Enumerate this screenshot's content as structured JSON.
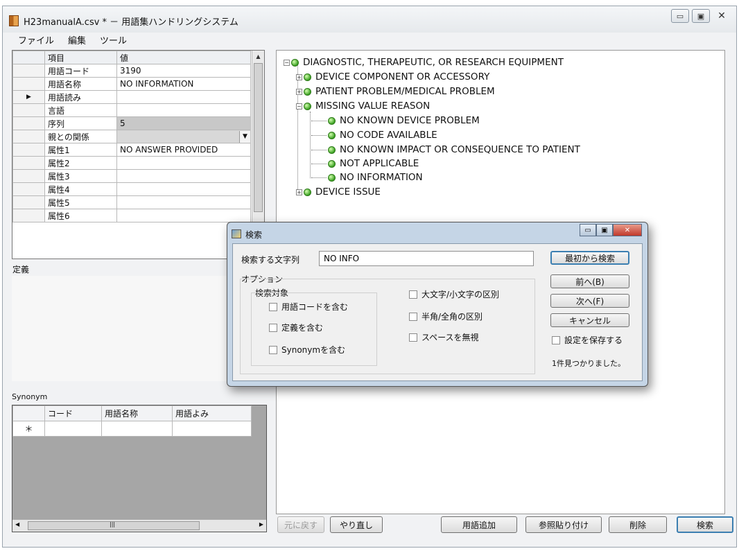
{
  "window": {
    "title": "H23manualA.csv * － 用語集ハンドリングシステム",
    "controls": {
      "minimize": "▭",
      "maximize": "▣",
      "close": "✕"
    }
  },
  "menu": [
    "ファイル",
    "編集",
    "ツール"
  ],
  "property_grid": {
    "headers": {
      "key": "項目",
      "value": "値"
    },
    "selected_row_marker": "▶",
    "rows": [
      {
        "key": "用語コード",
        "value": "3190"
      },
      {
        "key": "用語名称",
        "value": "NO INFORMATION"
      },
      {
        "key": "用語読み",
        "value": ""
      },
      {
        "key": "言語",
        "value": ""
      },
      {
        "key": "序列",
        "value": "5"
      },
      {
        "key": "親との関係",
        "value": ""
      },
      {
        "key": "属性1",
        "value": "NO ANSWER PROVIDED"
      },
      {
        "key": "属性2",
        "value": ""
      },
      {
        "key": "属性3",
        "value": ""
      },
      {
        "key": "属性4",
        "value": ""
      },
      {
        "key": "属性5",
        "value": ""
      },
      {
        "key": "属性6",
        "value": ""
      }
    ]
  },
  "definition": {
    "label": "定義"
  },
  "synonym": {
    "label": "Synonym",
    "headers": [
      "コード",
      "用語名称",
      "用語よみ"
    ],
    "new_row_marker": "＊"
  },
  "tree": [
    {
      "label": "DIAGNOSTIC, THERAPEUTIC, OR RESEARCH EQUIPMENT",
      "level": 0,
      "expander": "−"
    },
    {
      "label": "DEVICE COMPONENT OR ACCESSORY",
      "level": 1,
      "expander": "+"
    },
    {
      "label": "PATIENT PROBLEM/MEDICAL PROBLEM",
      "level": 1,
      "expander": "+"
    },
    {
      "label": "MISSING VALUE REASON",
      "level": 1,
      "expander": "−"
    },
    {
      "label": "NO KNOWN DEVICE PROBLEM",
      "level": 2,
      "expander": ""
    },
    {
      "label": "NO CODE AVAILABLE",
      "level": 2,
      "expander": ""
    },
    {
      "label": "NO KNOWN IMPACT OR CONSEQUENCE TO PATIENT",
      "level": 2,
      "expander": ""
    },
    {
      "label": "NOT APPLICABLE",
      "level": 2,
      "expander": ""
    },
    {
      "label": "NO INFORMATION",
      "level": 2,
      "expander": ""
    },
    {
      "label": "DEVICE ISSUE",
      "level": 1,
      "expander": "+"
    }
  ],
  "buttons": {
    "undo": "元に戻す",
    "redo": "やり直し",
    "add_term": "用語追加",
    "paste_ref": "参照貼り付け",
    "delete": "削除",
    "search": "検索"
  },
  "search_dialog": {
    "title": "検索",
    "query_label": "検索する文字列",
    "query_value": "NO INFO",
    "options_label": "オプション",
    "target_label": "検索対象",
    "checkboxes": {
      "include_code": "用語コードを含む",
      "include_definition": "定義を含む",
      "include_synonym": "Synonymを含む",
      "case_sensitive": "大文字/小文字の区別",
      "width_sensitive": "半角/全角の区別",
      "ignore_space": "スペースを無視",
      "save_settings": "設定を保存する"
    },
    "buttons": {
      "search_from_start": "最初から検索",
      "prev": "前へ(B)",
      "next": "次へ(F)",
      "cancel": "キャンセル"
    },
    "result": "1件見つかりました。"
  }
}
